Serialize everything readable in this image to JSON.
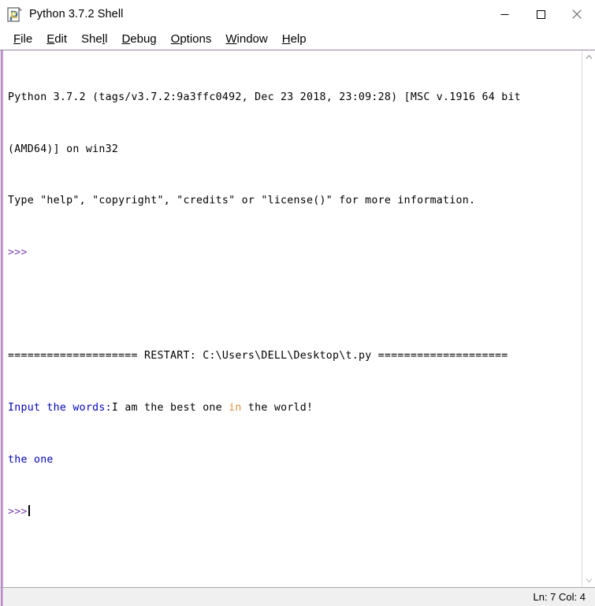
{
  "window": {
    "title": "Python 3.7.2 Shell",
    "icon": "python-idle-icon",
    "minimize_label": "—",
    "maximize_label": "□",
    "close_label": "✕"
  },
  "menubar": {
    "items": [
      {
        "label": "File",
        "mnemonic": "F",
        "rest": "ile"
      },
      {
        "label": "Edit",
        "mnemonic": "E",
        "rest": "dit"
      },
      {
        "label": "Shell",
        "mnemonic": "l",
        "pre": "She",
        "rest": "l"
      },
      {
        "label": "Debug",
        "mnemonic": "D",
        "rest": "ebug"
      },
      {
        "label": "Options",
        "mnemonic": "O",
        "rest": "ptions"
      },
      {
        "label": "Window",
        "mnemonic": "W",
        "rest": "indow"
      },
      {
        "label": "Help",
        "mnemonic": "H",
        "rest": "elp"
      }
    ]
  },
  "shell": {
    "banner_line_1": "Python 3.7.2 (tags/v3.7.2:9a3ffc0492, Dec 23 2018, 23:09:28) [MSC v.1916 64 bit",
    "banner_line_2": "(AMD64)] on win32",
    "banner_line_3": "Type \"help\", \"copyright\", \"credits\" or \"license()\" for more information.",
    "prompt": ">>>",
    "restart_bar_left": "====================",
    "restart_label": " RESTART: ",
    "restart_path": "C:\\Users\\DELL\\Desktop\\t.py",
    "restart_bar_right": " ====================",
    "input_prompt": "Input the words:",
    "user_input_part1": "I am the best one ",
    "user_input_keyword": "in",
    "user_input_part2": " the world!",
    "result_line": "the one",
    "final_prompt": ">>>"
  },
  "scrollbar": {
    "up_arrow": "∧",
    "down_arrow": "∨"
  },
  "statusbar": {
    "position": "Ln: 7  Col: 4"
  }
}
